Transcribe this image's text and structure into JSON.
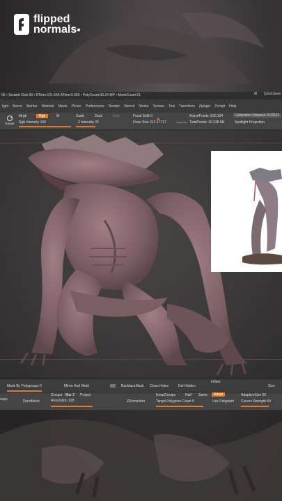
{
  "brand": {
    "line1": "flipped",
    "line2": "normals"
  },
  "status_bar": {
    "text": "05 • Scratch Disk 30 • RTime:121.645 ATime:0.003 • PolyCount:30.24 MP • MeshCount:21",
    "ai": "AI",
    "quicksave": "QuickSave"
  },
  "menus": [
    "light",
    "Macro",
    "Marker",
    "Material",
    "Movie",
    "Picker",
    "Preferences",
    "Render",
    "Stencil",
    "Stroke",
    "Texture",
    "Tool",
    "Transform",
    "Zplugin",
    "Zscript",
    "Help"
  ],
  "toolbar": {
    "rotate": "Rotate",
    "mrgb": "Mrgb",
    "rgb": "Rgb",
    "m": "M",
    "rgb_intensity": "Rgb Intensity 100",
    "zadd": "Zadd",
    "zsub": "Zsub",
    "zcut": "Zcut",
    "z_intensity": "Z Intensity 25",
    "focal_shift": "Focal Shift 0",
    "draw_size": "Draw Size 212.17717",
    "dynamic": "Dynamic",
    "active_points": "ActivePoints: 520,194",
    "total_points": "TotalPoints: 30.238 Mil",
    "calibration": "Calibration Distance 0.03522",
    "spotlight": "Spotlight Projection"
  },
  "subtool_row1": {
    "mask_polygroups": "Mask By Polygroups 0",
    "mirror_weld": "Mirror And Weld",
    "backface_mask": "BackfaceMask",
    "close_holes": "Close Holes",
    "del_hidden": "Del Hidden",
    "inflate": "Inflate",
    "size": "Size"
  },
  "subtool_row2": {
    "groups": "oups",
    "dynamesh": "DynaMesh",
    "groups_label": "Groups",
    "blur": "Blur 2",
    "project": "Project",
    "resolution": "Resolution 128",
    "zremesher": "ZRemesher",
    "keepgroups": "KeepGroups",
    "half": "Half",
    "same": "Same",
    "adapt": "Adapt",
    "target_polygons": "Target Polygons Count 5",
    "use_polypaint": "Use Polypaint",
    "adaptive_size": "AdaptiveSize 50",
    "curves_strength": "Curves Strength 50"
  },
  "colors": {
    "accent": "#e07a2a",
    "panel": "#454545",
    "model": "#8a6b70"
  }
}
